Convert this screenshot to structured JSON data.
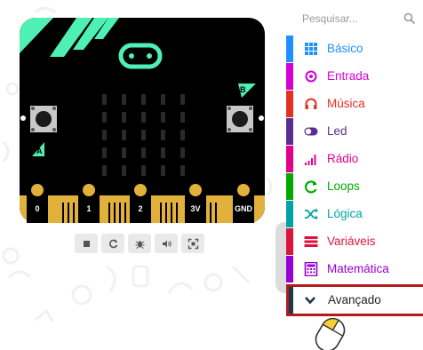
{
  "search": {
    "placeholder": "Pesquisar..."
  },
  "board": {
    "button_a": "A",
    "button_b": "B",
    "pins": [
      "0",
      "1",
      "2",
      "3V",
      "GND"
    ]
  },
  "simulator_toolbar": [
    {
      "icon": "stop-icon"
    },
    {
      "icon": "restart-icon"
    },
    {
      "icon": "debug-icon"
    },
    {
      "icon": "mute-icon"
    },
    {
      "icon": "fullscreen-icon"
    }
  ],
  "toolbox": {
    "categories": [
      {
        "label": "Básico",
        "color": "#1E90FF",
        "icon": "grid-icon"
      },
      {
        "label": "Entrada",
        "color": "#D400D4",
        "icon": "target-icon"
      },
      {
        "label": "Música",
        "color": "#E63022",
        "icon": "headphones-icon"
      },
      {
        "label": "Led",
        "color": "#5C2D91",
        "icon": "toggle-icon"
      },
      {
        "label": "Rádio",
        "color": "#E3008C",
        "icon": "signal-bars-icon"
      },
      {
        "label": "Loops",
        "color": "#00AA00",
        "icon": "loop-icon"
      },
      {
        "label": "Lógica",
        "color": "#00A4A6",
        "icon": "shuffle-icon"
      },
      {
        "label": "Variáveis",
        "color": "#DC143C",
        "icon": "lines-icon"
      },
      {
        "label": "Matemática",
        "color": "#9400D3",
        "icon": "calculator-icon"
      }
    ],
    "advanced": {
      "label": "Avançado",
      "icon": "chevron-down-icon",
      "highlight_color": "#B31B1B"
    }
  },
  "colors": {
    "board_black": "#000000",
    "board_accent": "#4EF0B4",
    "pin_gold": "#E2B13C"
  }
}
